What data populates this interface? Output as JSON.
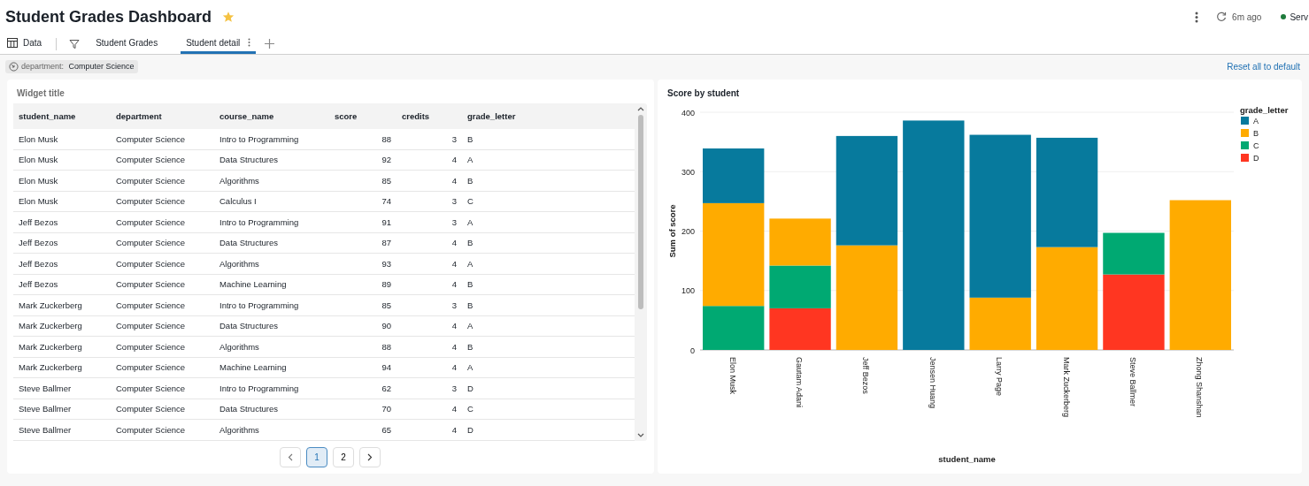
{
  "header": {
    "title": "Student Grades Dashboard",
    "favorite": true,
    "refresh_time": "6m ago",
    "status": "Serv"
  },
  "tabs": [
    {
      "kind": "data",
      "label": "Data",
      "selected": false
    },
    {
      "kind": "filter",
      "label": "Student Grades",
      "selected": false
    },
    {
      "kind": "page",
      "label": "Student detail",
      "selected": true
    }
  ],
  "filter_bar": {
    "filters": [
      {
        "field": "department:",
        "value": "Computer Science"
      }
    ],
    "reset_link": "Reset all to default"
  },
  "table_widget": {
    "title": "Widget title",
    "columns": [
      "student_name",
      "department",
      "course_name",
      "score",
      "credits",
      "grade_letter"
    ],
    "rows": [
      [
        "Elon Musk",
        "Computer Science",
        "Intro to Programming",
        "88",
        "3",
        "B"
      ],
      [
        "Elon Musk",
        "Computer Science",
        "Data Structures",
        "92",
        "4",
        "A"
      ],
      [
        "Elon Musk",
        "Computer Science",
        "Algorithms",
        "85",
        "4",
        "B"
      ],
      [
        "Elon Musk",
        "Computer Science",
        "Calculus I",
        "74",
        "3",
        "C"
      ],
      [
        "Jeff Bezos",
        "Computer Science",
        "Intro to Programming",
        "91",
        "3",
        "A"
      ],
      [
        "Jeff Bezos",
        "Computer Science",
        "Data Structures",
        "87",
        "4",
        "B"
      ],
      [
        "Jeff Bezos",
        "Computer Science",
        "Algorithms",
        "93",
        "4",
        "A"
      ],
      [
        "Jeff Bezos",
        "Computer Science",
        "Machine Learning",
        "89",
        "4",
        "B"
      ],
      [
        "Mark Zuckerberg",
        "Computer Science",
        "Intro to Programming",
        "85",
        "3",
        "B"
      ],
      [
        "Mark Zuckerberg",
        "Computer Science",
        "Data Structures",
        "90",
        "4",
        "A"
      ],
      [
        "Mark Zuckerberg",
        "Computer Science",
        "Algorithms",
        "88",
        "4",
        "B"
      ],
      [
        "Mark Zuckerberg",
        "Computer Science",
        "Machine Learning",
        "94",
        "4",
        "A"
      ],
      [
        "Steve Ballmer",
        "Computer Science",
        "Intro to Programming",
        "62",
        "3",
        "D"
      ],
      [
        "Steve Ballmer",
        "Computer Science",
        "Data Structures",
        "70",
        "4",
        "C"
      ],
      [
        "Steve Ballmer",
        "Computer Science",
        "Algorithms",
        "65",
        "4",
        "D"
      ]
    ],
    "pages": [
      {
        "label": "1",
        "selected": true
      },
      {
        "label": "2",
        "selected": false
      }
    ]
  },
  "chart_widget": {
    "title": "Score by student",
    "chart_data": {
      "type": "bar",
      "stacked": true,
      "orientation": "vertical",
      "xlabel": "student_name",
      "ylabel": "Sum of score",
      "grid": true,
      "legend": {
        "title": "grade_letter"
      },
      "categories": [
        "Elon Musk",
        "Gautam Adani",
        "Jeff Bezos",
        "Jensen Huang",
        "Larry Page",
        "Mark Zuckerberg",
        "Steve Ballmer",
        "Zhong Shanshan"
      ],
      "ylim": [
        0,
        400
      ],
      "yticks": [
        0,
        100,
        200,
        300,
        400
      ],
      "series": [
        {
          "name": "A",
          "color": "#077a9d",
          "values": [
            92,
            null,
            184,
            386,
            274,
            184,
            null,
            null
          ]
        },
        {
          "name": "B",
          "color": "#ffab00",
          "values": [
            173,
            79,
            176,
            null,
            88,
            173,
            null,
            252
          ]
        },
        {
          "name": "C",
          "color": "#00a972",
          "values": [
            74,
            72,
            null,
            null,
            null,
            null,
            70,
            null
          ]
        },
        {
          "name": "D",
          "color": "#ff3621",
          "values": [
            null,
            70,
            null,
            null,
            null,
            null,
            127,
            null
          ]
        }
      ]
    }
  }
}
